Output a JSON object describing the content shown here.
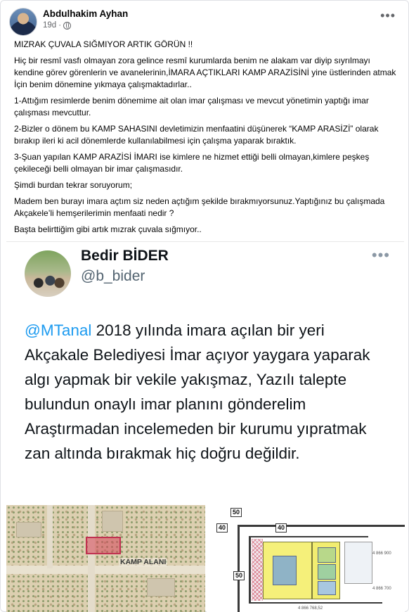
{
  "post": {
    "author": "Abdulhakim Ayhan",
    "time": "19d",
    "audience_icon": "globe-icon",
    "more_icon": "more-horizontal-icon",
    "paragraphs": [
      "MIZRAK ÇUVALA SIĞMIYOR ARTIK GÖRÜN !!",
      "Hiç bir resmî vasfı olmayan zora gelince resmî kurumlarda benim ne alakam var diyip sıyrılmayı kendine görev görenlerin ve avanelerinin,İMARA AÇTIKLARI KAMP ARAZİSİNİ yine üstlerinden atmak İçin benim dönemine yıkmaya çalışmaktadırlar..",
      "1-Attığım resimlerde benim dönemime ait olan imar çalışması ve mevcut yönetimin yaptığı imar çalışması mevcuttur.",
      "2-Bizler o dönem bu KAMP SAHASINI devletimizin menfaatini düşünerek “KAMP ARASİZİ” olarak bırakıp ileri ki acil dönemlerde kullanılabilmesi için çalışma yaparak bıraktık.",
      "3-Şuan yapılan KAMP ARAZİSİ İMARI ise kimlere ne hizmet ettiği belli olmayan,kimlere peşkeş çekileceği belli olmayan bir imar çalışmasıdır.",
      "Şimdi burdan tekrar soruyorum;",
      "Madem ben burayı imara açtım siz neden açtığım şekilde bırakmıyorsunuz.Yaptığınız bu çalışmada Akçakele’li hemşerilerimin menfaati nedir ?",
      "Başta belirttiğim gibi artık mızrak çuvala sığmıyor.."
    ]
  },
  "tweet": {
    "name": "Bedir BİDER",
    "handle": "@b_bider",
    "more_icon": "more-horizontal-icon",
    "mention": "@MTanal",
    "text": " 2018 yılında imara açılan bir yeri Akçakale Belediyesi İmar açıyor yaygara yaparak algı yapmak bir vekile yakışmaz, Yazılı talepte bulundun onaylı imar planını gönderelim Araştırmadan incelemeden bir kurumu yıpratmak zan altında bırakmak hiç doğru değildir."
  },
  "images": {
    "satellite_label": "KAMP ALANI",
    "plan_road_labels": [
      "50",
      "40",
      "40",
      "50"
    ],
    "plan_coords": [
      "4 866 900",
      "4 866 700"
    ],
    "plan_coord_bottom": "4 866 768,52"
  },
  "colors": {
    "mention": "#1d9bf0",
    "handle": "#536471",
    "meta": "#65676b"
  }
}
